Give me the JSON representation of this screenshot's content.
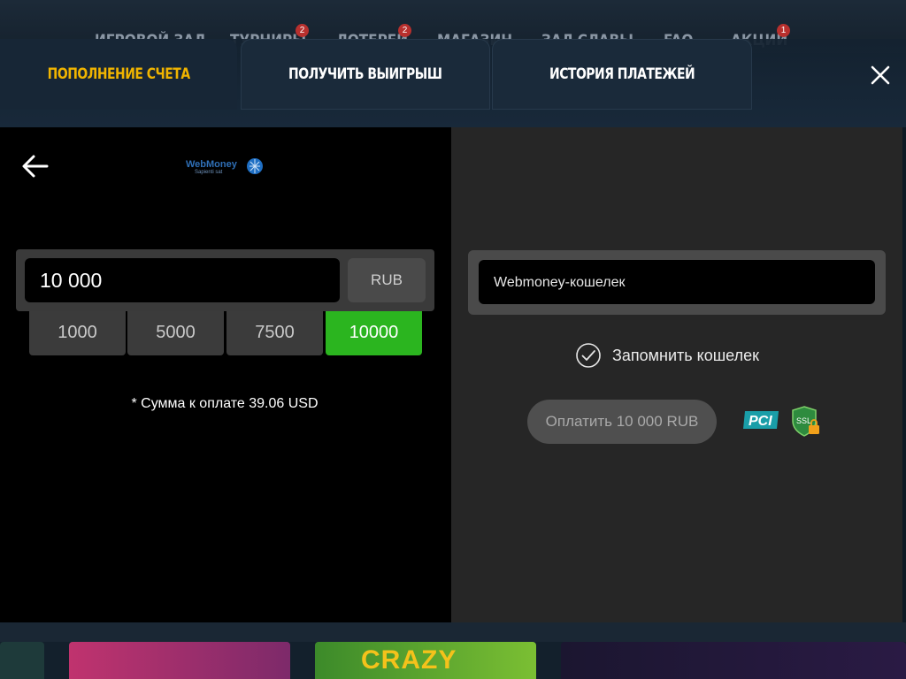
{
  "background": {
    "nav_items": [
      {
        "label": "ИГРОВОЙ ЗАЛ",
        "badge": ""
      },
      {
        "label": "ТУРНИРЫ",
        "badge": "2"
      },
      {
        "label": "ЛОТЕРЕИ",
        "badge": "2"
      },
      {
        "label": "МАГАЗИН",
        "badge": ""
      },
      {
        "label": "ЗАЛ СЛАВЫ",
        "badge": ""
      },
      {
        "label": "FAQ",
        "badge": ""
      },
      {
        "label": "АКЦИИ",
        "badge": "1"
      }
    ],
    "thumbnail_text": "CRAZY"
  },
  "tabs": [
    {
      "label": "ПОПОЛНЕНИЕ СЧЕТА",
      "active": true
    },
    {
      "label": "ПОЛУЧИТЬ ВЫИГРЫШ",
      "active": false
    },
    {
      "label": "ИСТОРИЯ ПЛАТЕЖЕЙ",
      "active": false
    }
  ],
  "payment_method": {
    "logo_text": "WebMoney",
    "logo_subtext": "Sapienti sat"
  },
  "amount": {
    "value": "10 000",
    "currency": "RUB",
    "presets": [
      "1000",
      "5000",
      "7500",
      "10000"
    ],
    "selected_preset": "10000",
    "note": "* Сумма к оплате 39.06 USD"
  },
  "wallet": {
    "placeholder": "Webmoney-кошелек",
    "remember_label": "Запомнить кошелек",
    "remember_checked": true
  },
  "pay_button": {
    "label": "Оплатить 10 000 RUB"
  },
  "security_badges": [
    "PCI",
    "SSL"
  ],
  "colors": {
    "active_tab": "#f0b400",
    "selected_preset": "#2bb51f",
    "left_panel": "#000000",
    "right_panel": "#262626"
  }
}
